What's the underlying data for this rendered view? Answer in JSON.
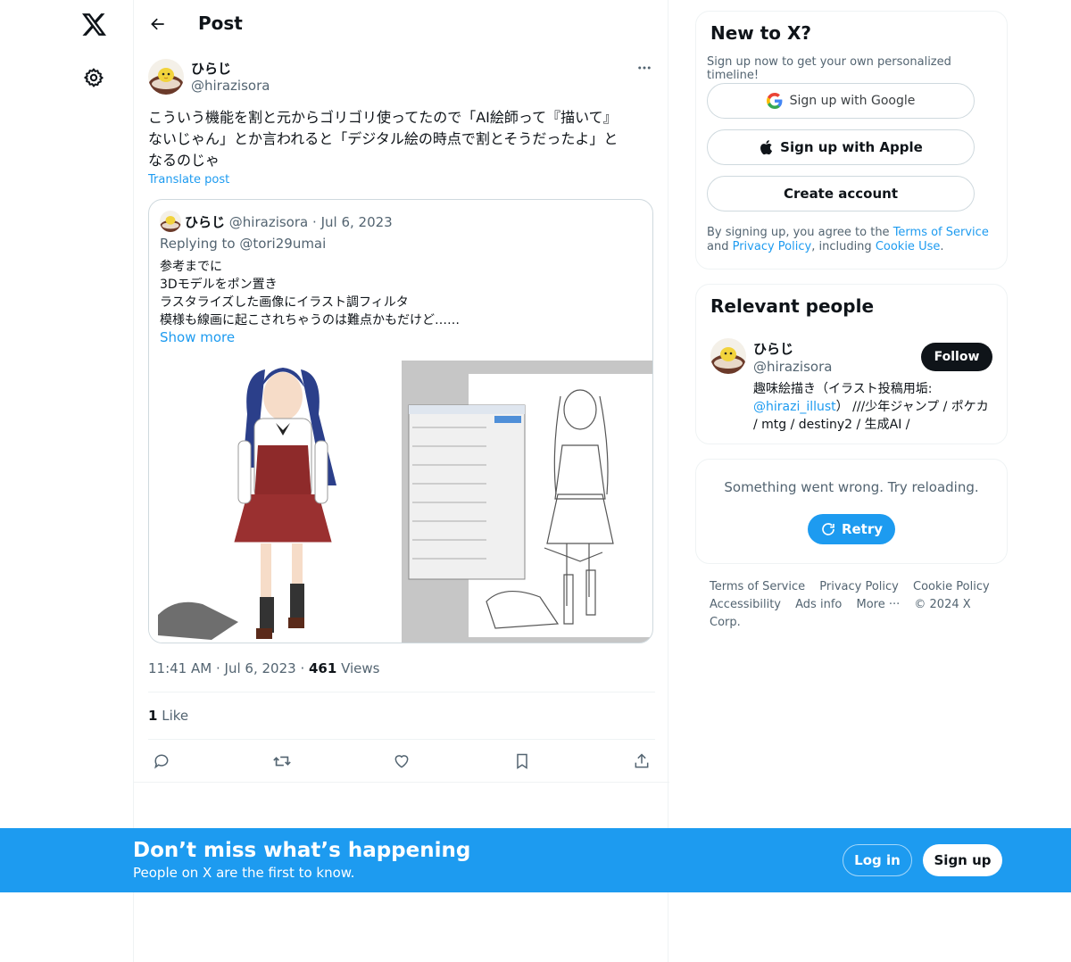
{
  "header": {
    "title": "Post"
  },
  "post": {
    "author_name": "ひらじ",
    "author_handle": "@hirazisora",
    "text": "こういう機能を割と元からゴリゴリ使ってたので「AI絵師って『描いて』\nないじゃん」とか言われると「デジタル絵の時点で割とそうだったよ」と\nなるのじゃ",
    "translate_label": "Translate post",
    "time": "11:41 AM",
    "date": "Jul 6, 2023",
    "views_count": "461",
    "views_label": "Views",
    "likes_count": "1",
    "likes_label": "Like",
    "quote": {
      "author_name": "ひらじ",
      "author_handle": "@hirazisora",
      "date": "Jul 6, 2023",
      "replying_to": "Replying to @tori29umai",
      "text": "参考までに\n3Dモデルをポン置き\nラスタライズした画像にイラスト調フィルタ\n模様も線画に起こされちゃうのは難点かもだけど……",
      "show_more": "Show more"
    }
  },
  "signup": {
    "title": "New to X?",
    "subtitle": "Sign up now to get your own personalized timeline!",
    "google_label": "Sign up with Google",
    "apple_label": "Sign up with Apple",
    "create_label": "Create account",
    "legal_prefix": "By signing up, you agree to the ",
    "terms": "Terms of Service",
    "legal_and": " and ",
    "privacy": "Privacy Policy",
    "legal_including": ", including ",
    "cookie": "Cookie Use",
    "legal_end": "."
  },
  "relevant": {
    "title": "Relevant people",
    "name": "ひらじ",
    "handle": "@hirazisora",
    "follow_label": "Follow",
    "bio_prefix": "趣味絵描き（イラスト投稿用垢: ",
    "bio_link": "@hirazi_illust",
    "bio_suffix": "） ///少年ジャンプ / ポケカ / mtg / destiny2 / 生成AI /"
  },
  "error": {
    "message": "Something went wrong. Try reloading.",
    "retry_label": "Retry"
  },
  "footer": {
    "links": [
      "Terms of Service",
      "Privacy Policy",
      "Cookie Policy",
      "Accessibility",
      "Ads info",
      "More ···"
    ],
    "copyright": "© 2024 X Corp."
  },
  "banner": {
    "title": "Don’t miss what’s happening",
    "subtitle": "People on X are the first to know.",
    "login_label": "Log in",
    "signup_label": "Sign up"
  },
  "colors": {
    "accent": "#1d9bf0",
    "text": "#0f1419",
    "secondary": "#536471",
    "border": "#eff3f4"
  }
}
